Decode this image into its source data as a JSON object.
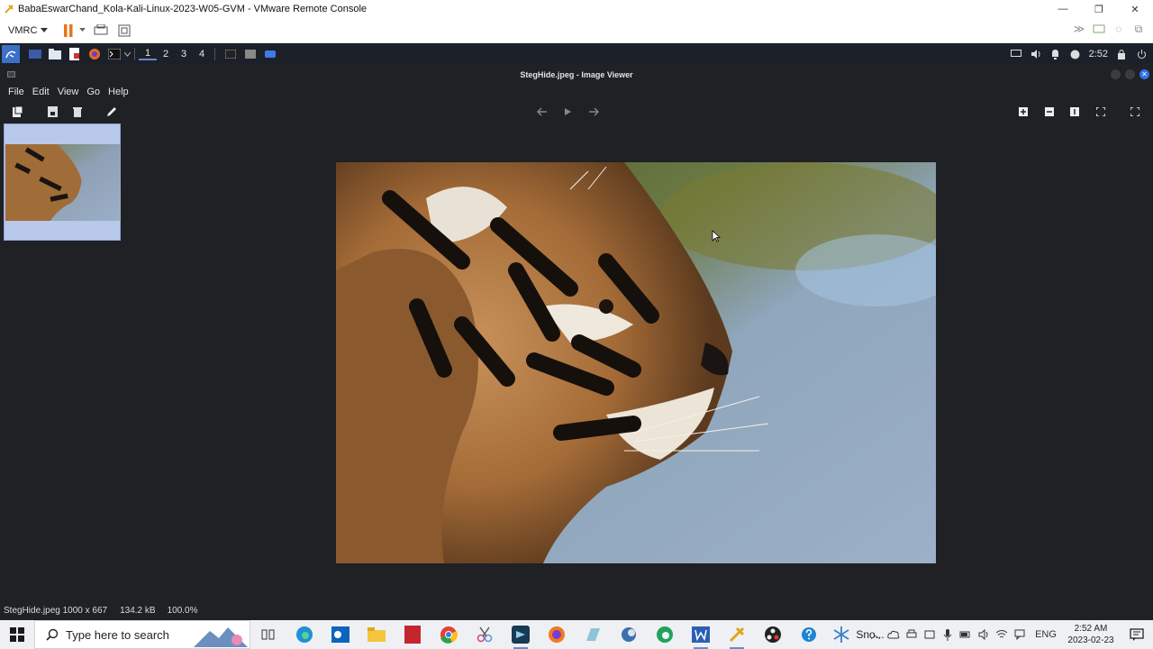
{
  "vmware": {
    "window_title": "BabaEswarChand_Kola-Kali-Linux-2023-W05-GVM - VMware Remote Console",
    "menu_label": "VMRC",
    "controls": {
      "minimize": "—",
      "restore": "❐",
      "close": "✕"
    }
  },
  "kali_panel": {
    "workspaces": [
      "1",
      "2",
      "3",
      "4"
    ],
    "active_workspace": "1",
    "time": "2:52"
  },
  "viewer": {
    "title": "StegHide.jpeg - Image Viewer",
    "menu": [
      "File",
      "Edit",
      "View",
      "Go",
      "Help"
    ],
    "status": {
      "file_info": "StegHide.jpeg 1000 x 667",
      "file_size": "134.2 kB",
      "zoom": "100.0%"
    }
  },
  "taskbar": {
    "search_placeholder": "Type here to search",
    "pinned_label": "Sno...",
    "language": "ENG",
    "time": "2:52 AM",
    "date": "2023-02-23"
  },
  "colors": {
    "accent": "#2f6fe6",
    "viewer_bg": "#1f2124",
    "thumb_selected": "#b9c9ea"
  }
}
